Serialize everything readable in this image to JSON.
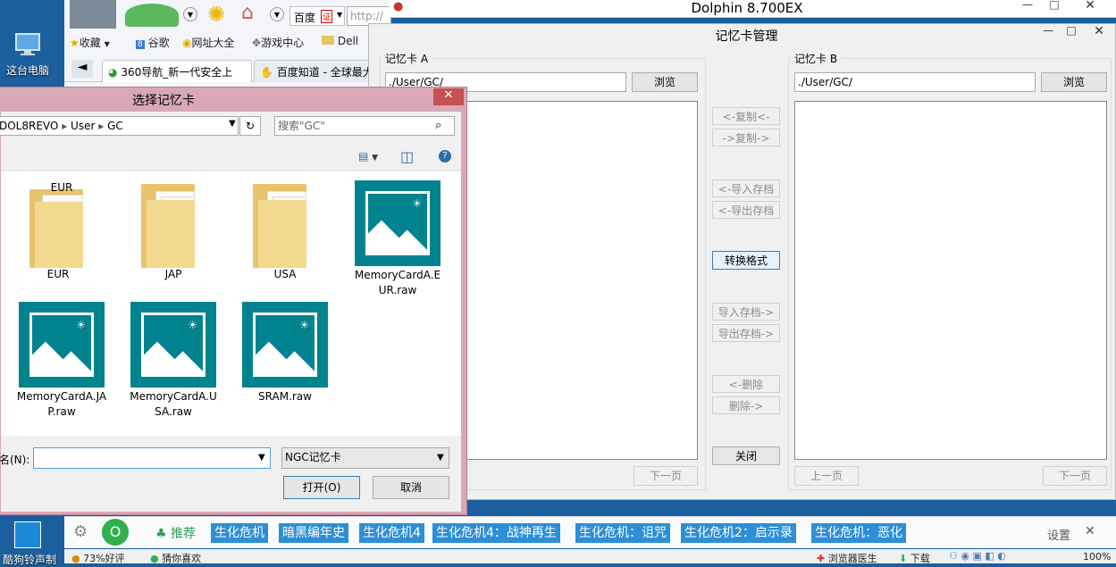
{
  "desktop": {
    "this_pc_label": "这台电脑",
    "taskbar_app_label": "酷狗铃声制"
  },
  "browser": {
    "search_engine_label": "百度",
    "search_badge": "证",
    "url_text": "http://",
    "bookmarks": [
      "收藏",
      "谷歌",
      "网址大全",
      "游戏中心",
      "Dell"
    ],
    "tabs": [
      "360导航_新一代安全上",
      "百度知道 - 全球最大"
    ],
    "recommend_label": "推荐",
    "games": [
      "生化危机",
      "暗黑编年史",
      "生化危机4",
      "生化危机4：战神再生",
      "生化危机：诅咒",
      "生化危机2：启示录",
      "生化危机：恶化"
    ],
    "settings_label": "设置",
    "status_rating": "73%好评",
    "status_guess": "猜你喜欢",
    "status_doctor": "浏览器医生",
    "status_download": "下载",
    "status_zoom": "100%"
  },
  "dolphin": {
    "title": "Dolphin 8.700EX"
  },
  "memcard": {
    "title": "记忆卡管理",
    "card_a_label": "记忆卡 A",
    "card_a_path": "./User/GC/",
    "card_b_label": "记忆卡 B",
    "card_b_path": "./User/GC/",
    "browse_label": "浏览",
    "copy_left": "<-复制<-",
    "copy_right": "->复制->",
    "import_left": "<-导入存档",
    "export_left": "<-导出存档",
    "convert": "转换格式",
    "import_right": "导入存档->",
    "export_right": "导出存档->",
    "delete_left": "<-删除",
    "delete_right": "删除->",
    "close": "关闭",
    "prev_page": "上一页",
    "next_page": "下一页"
  },
  "picker": {
    "title": "选择记忆卡",
    "breadcrumb": [
      "DOL8REVO",
      "User",
      "GC"
    ],
    "search_placeholder": "搜索\"GC\"",
    "filename_label": "名(N):",
    "filetype": "NGC记忆卡",
    "open_label": "打开(O)",
    "cancel_label": "取消",
    "files": [
      {
        "name": "EUR",
        "kind": "folder"
      },
      {
        "name": "JAP",
        "kind": "folder"
      },
      {
        "name": "USA",
        "kind": "folder"
      },
      {
        "name": "MemoryCardA.EUR.raw",
        "kind": "raw"
      },
      {
        "name": "MemoryCardA.JAP.raw",
        "kind": "raw"
      },
      {
        "name": "MemoryCardA.USA.raw",
        "kind": "raw"
      },
      {
        "name": "SRAM.raw",
        "kind": "raw"
      }
    ]
  }
}
